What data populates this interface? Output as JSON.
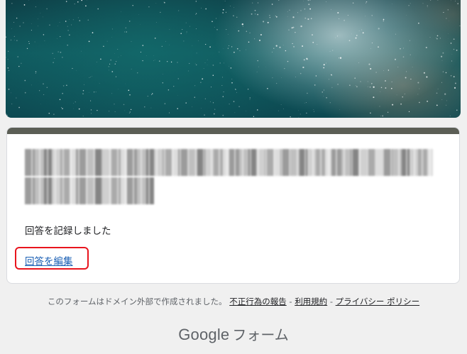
{
  "form": {
    "title_redacted": "",
    "confirmation_message": "回答を記録しました",
    "edit_link_label": "回答を編集"
  },
  "footer": {
    "note": "このフォームはドメイン外部で作成されました。",
    "links": [
      {
        "label": "不正行為の報告"
      },
      {
        "label": "利用規約"
      },
      {
        "label": "プライバシー ポリシー"
      }
    ],
    "separator": " - ",
    "brand_google": "Google",
    "brand_product": "フォーム"
  },
  "colors": {
    "accent_bar": "#5b5e55",
    "link": "#1a5fb4",
    "highlight_box": "#e8141d",
    "background": "#f0f0f0"
  },
  "icons": {
    "banner": "starry-sky-image"
  }
}
